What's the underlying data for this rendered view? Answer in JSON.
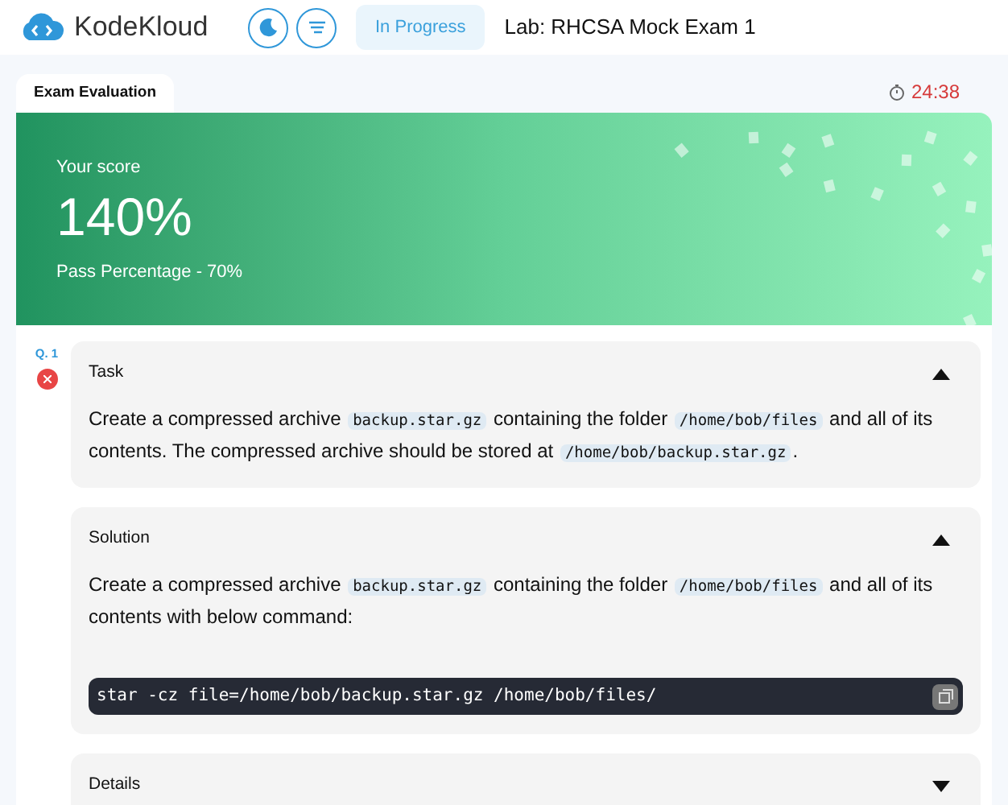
{
  "header": {
    "logo": "KodeKloud",
    "status": "In Progress",
    "lab_title": "Lab: RHCSA Mock Exam 1"
  },
  "tab": {
    "label": "Exam Evaluation",
    "selected": true
  },
  "timer": "24:38",
  "score": {
    "label": "Your score",
    "value": "140%",
    "pass": "Pass Percentage - 70%"
  },
  "question": {
    "number": "Q. 1",
    "passed": false,
    "sections": [
      {
        "title": "Task",
        "expanded": true,
        "paragraph": [
          {
            "kind": "text",
            "text": "Create a compressed archive "
          },
          {
            "kind": "code",
            "text": "backup.star.gz"
          },
          {
            "kind": "text",
            "text": " containing the folder "
          },
          {
            "kind": "code",
            "text": "/home/bob/files"
          },
          {
            "kind": "text",
            "text": " and all of its contents. The compressed archive should be stored at "
          },
          {
            "kind": "code",
            "text": "/home/bob/backup.star.gz"
          },
          {
            "kind": "text",
            "text": "."
          }
        ]
      },
      {
        "title": "Solution",
        "expanded": true,
        "paragraph": [
          {
            "kind": "text",
            "text": "Create a compressed archive "
          },
          {
            "kind": "code",
            "text": "backup.star.gz"
          },
          {
            "kind": "text",
            "text": " containing the folder "
          },
          {
            "kind": "code",
            "text": "/home/bob/files"
          },
          {
            "kind": "text",
            "text": " and all of its contents with below command:"
          }
        ],
        "command": "star -cz file=/home/bob/backup.star.gz /home/bob/files/"
      },
      {
        "title": "Details",
        "expanded": false
      }
    ]
  }
}
